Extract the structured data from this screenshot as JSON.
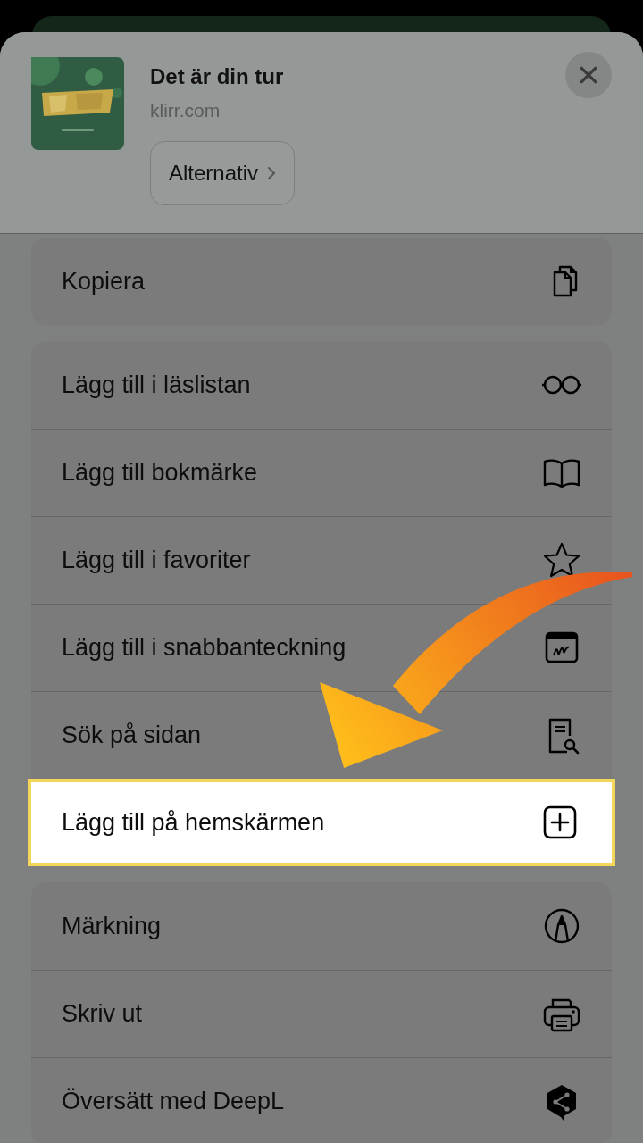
{
  "header": {
    "title": "Det är din tur",
    "domain": "klirr.com",
    "options_button": "Alternativ"
  },
  "groups": [
    {
      "items": [
        {
          "label": "Kopiera",
          "kind": "copy",
          "selected": false
        }
      ]
    },
    {
      "items": [
        {
          "label": "Lägg till i läslistan",
          "kind": "glasses",
          "selected": false
        },
        {
          "label": "Lägg till bokmärke",
          "kind": "book",
          "selected": false
        },
        {
          "label": "Lägg till i favoriter",
          "kind": "star",
          "selected": false
        },
        {
          "label": "Lägg till i snabbanteckning",
          "kind": "note",
          "selected": false
        },
        {
          "label": "Sök på sidan",
          "kind": "find",
          "selected": false
        },
        {
          "label": "Lägg till på hemskärmen",
          "kind": "add",
          "selected": true
        }
      ]
    },
    {
      "items": [
        {
          "label": "Märkning",
          "kind": "markup",
          "selected": false
        },
        {
          "label": "Skriv ut",
          "kind": "print",
          "selected": false
        },
        {
          "label": "Översätt med DeepL",
          "kind": "deepl",
          "selected": false
        }
      ]
    }
  ],
  "callout_arrow": true
}
